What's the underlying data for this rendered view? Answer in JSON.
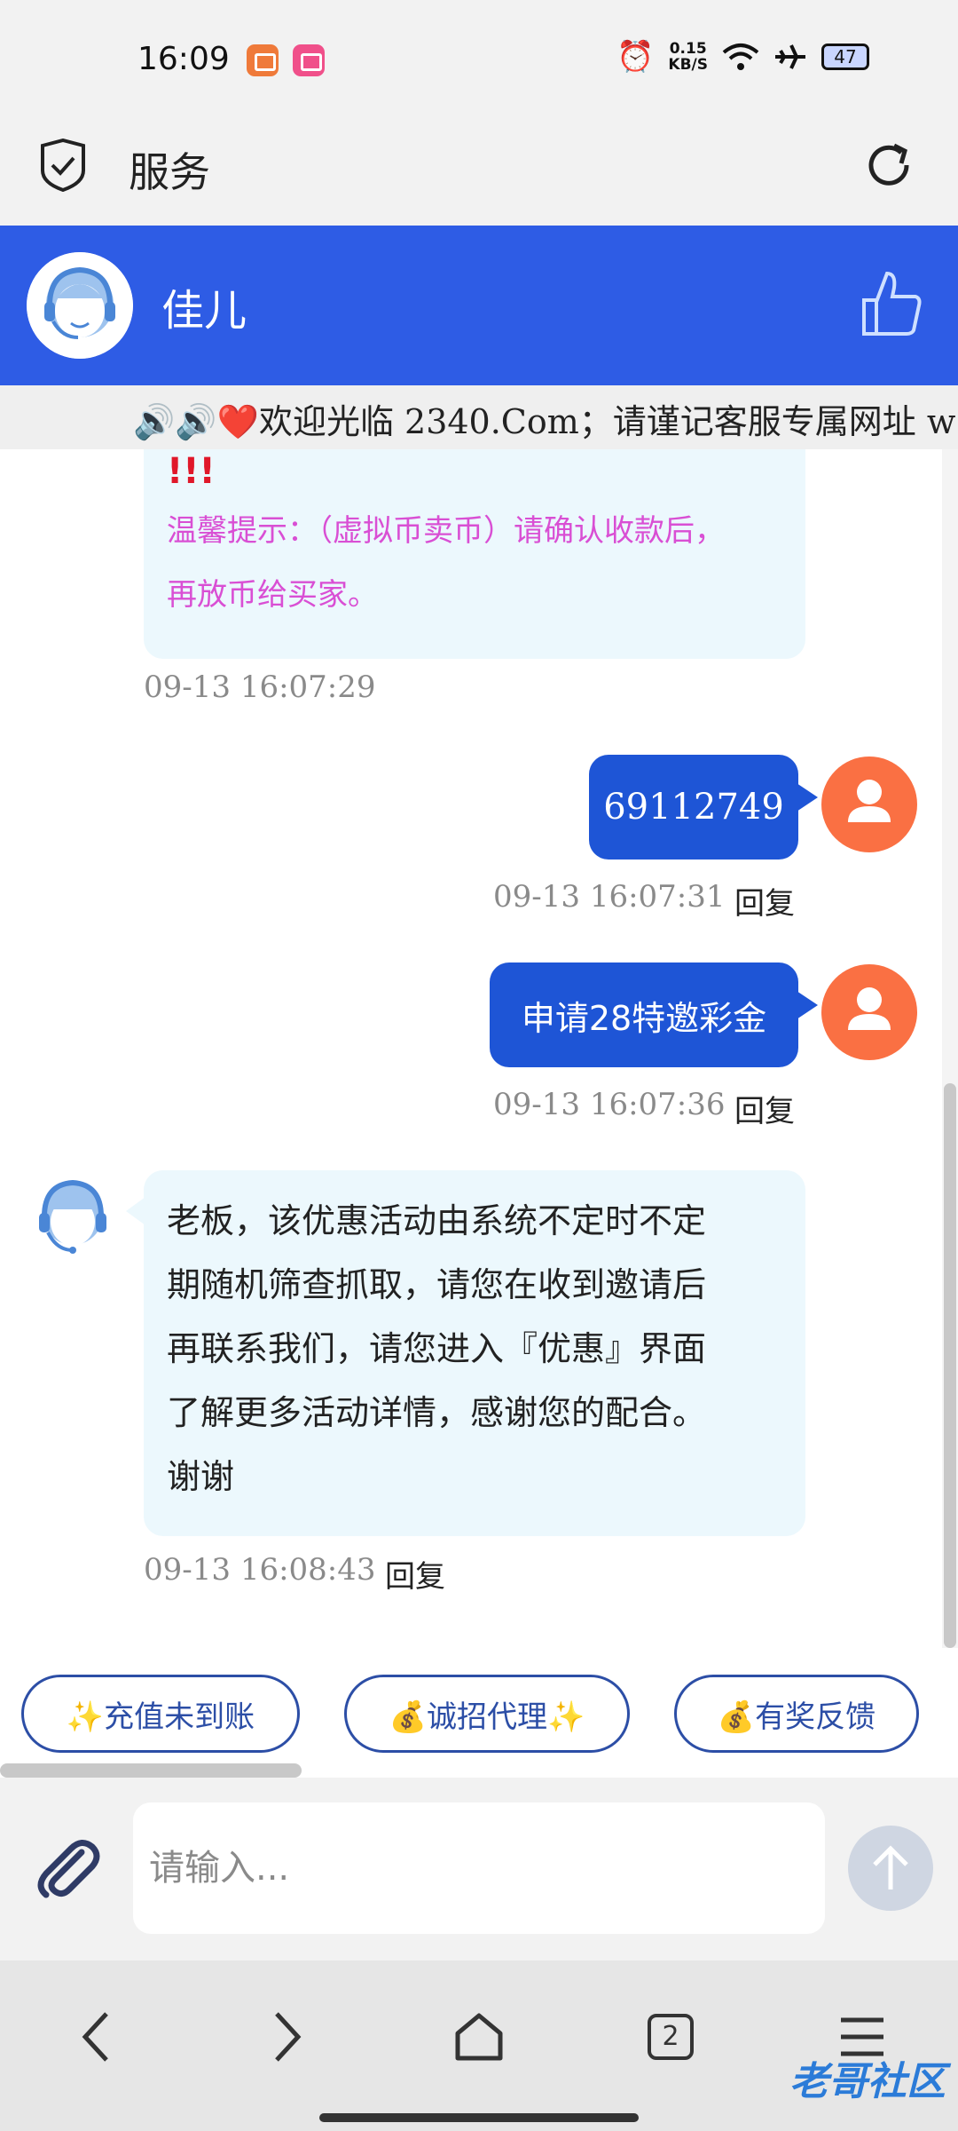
{
  "status_bar": {
    "time": "16:09",
    "net_speed_value": "0.15",
    "net_speed_unit": "KB/S",
    "battery": "47"
  },
  "browser": {
    "title": "服务"
  },
  "chat_header": {
    "agent_name": "佳儿"
  },
  "marquee": {
    "text": "🔊🔊❤️欢迎光临 2340.Com；请谨记客服专属网址 w"
  },
  "messages": {
    "m1": {
      "exclaim": "!!!",
      "line1": "温馨提示：（虚拟币卖币）请确认收款后，",
      "line2": "再放币给买家。",
      "time": "09-13 16:07:29"
    },
    "m2": {
      "text": "69112749",
      "time": "09-13 16:07:31",
      "reply": "回复"
    },
    "m3": {
      "text": "申请28特邀彩金",
      "time": "09-13 16:07:36",
      "reply": "回复"
    },
    "m4": {
      "line1": "老板，该优惠活动由系统不定时不定",
      "line2": "期随机筛查抓取，请您在收到邀请后",
      "line3": "再联系我们，请您进入『优惠』界面",
      "line4": "了解更多活动详情，感谢您的配合。",
      "line5": "谢谢",
      "time": "09-13 16:08:43",
      "reply": "回复"
    }
  },
  "quick_replies": [
    "✨充值未到账",
    "💰诚招代理✨",
    "💰有奖反馈"
  ],
  "input": {
    "placeholder": "请输入..."
  },
  "nav": {
    "tabs_count": "2"
  },
  "watermark": "老哥社区",
  "colors": {
    "header_blue": "#2e5ce5",
    "out_bubble": "#1e55d6",
    "in_bubble": "#ecf8fd",
    "user_avatar": "#fa7043",
    "pink_notice": "#d94fd4"
  }
}
